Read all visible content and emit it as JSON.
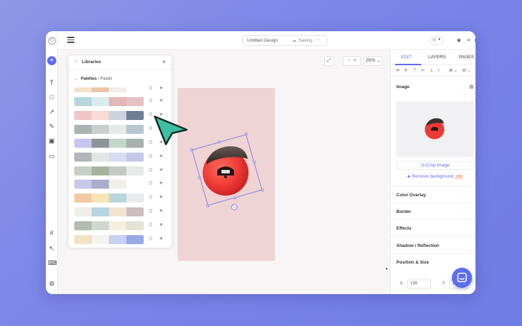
{
  "rail": {
    "logo": "G",
    "add_label": "+",
    "tools": [
      {
        "name": "text-tool-icon",
        "glyph": "T"
      },
      {
        "name": "shape-tool-icon",
        "glyph": "□"
      },
      {
        "name": "arrow-tool-icon",
        "glyph": "↗"
      },
      {
        "name": "draw-tool-icon",
        "glyph": "✎"
      },
      {
        "name": "image-tool-icon",
        "glyph": "▣"
      },
      {
        "name": "frame-tool-icon",
        "glyph": "▭"
      },
      {
        "name": "grid-tool-icon",
        "glyph": "#"
      },
      {
        "name": "select-tool-icon",
        "glyph": "↖"
      },
      {
        "name": "keyboard-icon",
        "glyph": "⌨"
      },
      {
        "name": "settings-tool-icon",
        "glyph": "⚙"
      }
    ]
  },
  "topbar": {
    "doc_title": "Untitled Design",
    "save_status": "Saving",
    "save_chevron": "⌄",
    "cloud_glyph": "☁",
    "clock_glyph": "◷",
    "comment_glyph": "●",
    "eye_glyph": "◉",
    "share_glyph": "⋖",
    "avatar_glyph": "●"
  },
  "libraries": {
    "title": "Libraries",
    "grip": "⠿",
    "close": "×",
    "back": "←",
    "crumb_root": "Palettes",
    "crumb_sep": " / ",
    "crumb_current": "Pastel",
    "shuffle_glyph": "⤨",
    "heart_glyph": "♥"
  },
  "palettes": [
    [
      "#f3e1cc",
      "#eac7a9",
      "#f4ece6",
      "#ffffff"
    ],
    [
      "#b7d6e0",
      "#d9ecee",
      "#e3b7b8",
      "#e6c1c3"
    ],
    [
      "#f0c6c6",
      "#f6dcd4",
      "#cdd3dd",
      "#6f7e94"
    ],
    [
      "#a9b4b4",
      "#c8d0cf",
      "#e6e9e9",
      "#b7c6cf"
    ],
    [
      "#c4c6f0",
      "#8e959a",
      "#c2d6cb",
      "#a8b0b0"
    ],
    [
      "#b3b6b8",
      "#e2e6e3",
      "#d7dcf3",
      "#c5c8e9"
    ],
    [
      "#c6cec6",
      "#a7b49d",
      "#c3cbc3",
      "#e7e9e9"
    ],
    [
      "#c9c6ea",
      "#abadcb",
      "#f1efe9",
      "#ffffff"
    ],
    [
      "#f2c9a2",
      "#f5e3b3",
      "#b9d6dd",
      "#e9eaec"
    ],
    [
      "#f0eeea",
      "#b7d4e2",
      "#f3e4d2",
      "#cdbdbf"
    ],
    [
      "#b2bdb0",
      "#d0d6d0",
      "#f4efdc",
      "#e4e2d5"
    ],
    [
      "#f3e2c1",
      "#f4f1ef",
      "#c8d0f1",
      "#98a9e7"
    ]
  ],
  "canvas": {
    "fit_glyph": "⤢",
    "zoom_out": "−",
    "zoom_in": "+",
    "zoom_level": "26%",
    "zoom_chevron": "⌄",
    "rotate_glyph": "↻",
    "expand_glyph": "▸"
  },
  "panel": {
    "tabs": [
      "EDIT",
      "LAYERS",
      "PAGES"
    ],
    "align_glyphs": [
      "⊫",
      "⊪",
      "⊤",
      "⊨",
      "⊥",
      "⊦",
      "⊞",
      "⌄",
      "⊟",
      "⌄"
    ],
    "image_title": "Image",
    "texture_glyph": "▦",
    "crop_glyph": "⊡",
    "crop_label": "Crop Image",
    "remove_bg_glyph": "◈",
    "remove_bg_label": "Remove background",
    "remove_bg_badge": "200",
    "sections": [
      "Color Overlay",
      "Border",
      "Effects",
      "Shadow / Reflection",
      "Position & Size"
    ],
    "pos_x_label": "X",
    "pos_x_value": "139",
    "pos_y_label": "Y",
    "pos_y_value": "3"
  },
  "colors": {
    "accent": "#5b6df2",
    "cursor": "#3dbfa3",
    "artboard": "#f0d3d3",
    "ball_red": "#ef3b3b"
  }
}
